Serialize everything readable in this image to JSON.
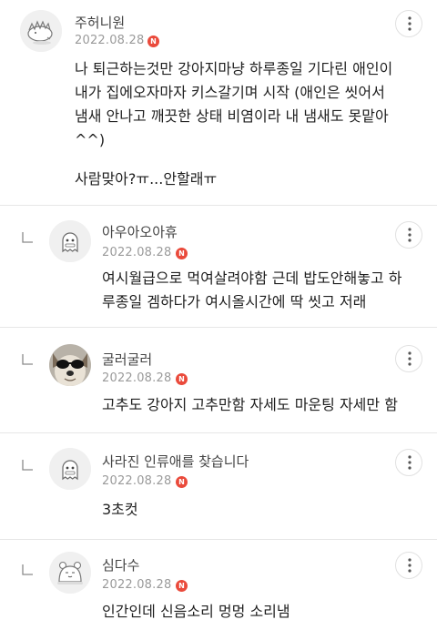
{
  "comments": [
    {
      "username": "주허니원",
      "date": "2022.08.28",
      "badge": "N",
      "avatar": "hedgehog-avatar-icon",
      "lines": [
        "나 퇴근하는것만 강아지마냥 하루종일 기다린 애인이",
        "내가 집에오자마자 키스갈기며 시작 (애인은 씻어서",
        "냄새 안나고 깨끗한 상태 비염이라 내 냄새도 못맡아",
        "^^)",
        "",
        "사람맞아?ㅠ...안할래ㅠ"
      ]
    },
    {
      "username": "아우아오아휴",
      "date": "2022.08.28",
      "badge": "N",
      "avatar": "ghost-avatar-icon",
      "lines": [
        "여시월급으로 먹여살려야함 근데 밥도안해놓고 하",
        "루종일 겜하다가 여시올시간에 딱 씻고 저래"
      ]
    },
    {
      "username": "굴러굴러",
      "date": "2022.08.28",
      "badge": "N",
      "avatar": "dog-with-sunglasses-photo",
      "lines": [
        "고추도 강아지 고추만함 자세도 마운팅 자세만 함"
      ]
    },
    {
      "username": "사라진 인류애를 찾습니다",
      "date": "2022.08.28",
      "badge": "N",
      "avatar": "ghost-avatar-icon",
      "lines": [
        "3초컷"
      ]
    },
    {
      "username": "심다수",
      "date": "2022.08.28",
      "badge": "N",
      "avatar": "hamster-avatar-icon",
      "lines": [
        "인간인데 신음소리 멍멍 소리냄"
      ]
    }
  ],
  "colors": {
    "badge": "#ea4a3b",
    "divider": "#e6e6e6",
    "date": "#9a9a9a",
    "username": "#444444"
  },
  "icons": {
    "more": "more-vertical-icon",
    "reply": "reply-arrow-icon",
    "new": "new-badge-icon"
  }
}
